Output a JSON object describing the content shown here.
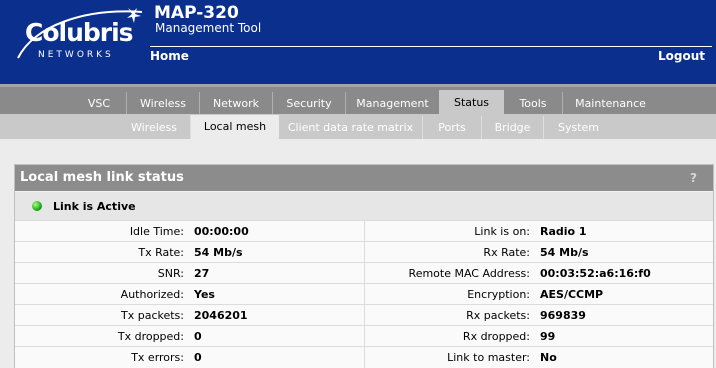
{
  "header": {
    "logo_name": "Colubris",
    "logo_sub": "NETWORKS",
    "product": "MAP-320",
    "subtitle": "Management Tool",
    "home_label": "Home",
    "logout_label": "Logout",
    "bg_color": "#0b2f8c"
  },
  "main_tabs": [
    "VSC",
    "Wireless",
    "Network",
    "Security",
    "Management",
    "Status",
    "Tools",
    "Maintenance"
  ],
  "main_active": "Status",
  "sub_tabs": [
    "Wireless",
    "Local mesh",
    "Client data rate matrix",
    "Ports",
    "Bridge",
    "System"
  ],
  "sub_active": "Local mesh",
  "panel": {
    "title": "Local mesh link status",
    "help": "?",
    "link_status": "Link is Active",
    "led_color": "#1fa81f"
  },
  "stats": [
    {
      "l1": "Idle Time:",
      "v1": "00:00:00",
      "l2": "Link is on:",
      "v2": "Radio 1"
    },
    {
      "l1": "Tx Rate:",
      "v1": "54 Mb/s",
      "l2": "Rx Rate:",
      "v2": "54 Mb/s"
    },
    {
      "l1": "SNR:",
      "v1": "27",
      "l2": "Remote MAC Address:",
      "v2": "00:03:52:a6:16:f0"
    },
    {
      "l1": "Authorized:",
      "v1": "Yes",
      "l2": "Encryption:",
      "v2": "AES/CCMP"
    },
    {
      "l1": "Tx packets:",
      "v1": "2046201",
      "l2": "Rx packets:",
      "v2": "969839"
    },
    {
      "l1": "Tx dropped:",
      "v1": "0",
      "l2": "Rx dropped:",
      "v2": "99"
    },
    {
      "l1": "Tx errors:",
      "v1": "0",
      "l2": "Link to master:",
      "v2": "No"
    }
  ]
}
